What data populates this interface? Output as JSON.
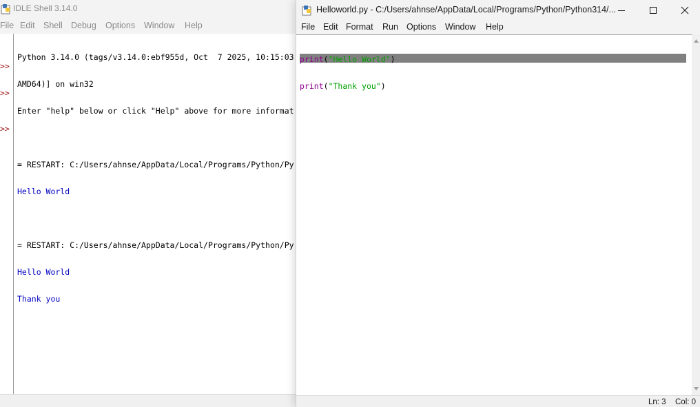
{
  "shell": {
    "title": "IDLE Shell 3.14.0",
    "menu": [
      "File",
      "Edit",
      "Shell",
      "Debug",
      "Options",
      "Window",
      "Help"
    ],
    "lines": [
      "Python 3.14.0 (tags/v3.14.0:ebf955d, Oct  7 2025, 10:15:03",
      "AMD64)] on win32",
      "Enter \"help\" below or click \"Help\" above for more informat",
      "",
      "= RESTART: C:/Users/ahnse/AppData/Local/Programs/Python/Py",
      "Hello World",
      "",
      "= RESTART: C:/Users/ahnse/AppData/Local/Programs/Python/Py",
      "Hello World",
      "Thank you"
    ],
    "prompt": ">>"
  },
  "editor": {
    "title": "Helloworld.py - C:/Users/ahnse/AppData/Local/Programs/Python/Python314/...",
    "menu": [
      "File",
      "Edit",
      "Format",
      "Run",
      "Options",
      "Window",
      "Help"
    ],
    "code": [
      {
        "func": "print",
        "open": "(",
        "str": "\"Hello World\"",
        "close": ")"
      },
      {
        "func": "print",
        "open": "(",
        "str": "\"Thank you\"",
        "close": ")"
      }
    ],
    "status": {
      "line": "Ln: 3",
      "col": "Col: 0"
    }
  },
  "icons": {
    "app": "python-idle-icon",
    "minimize": "minimize-icon",
    "maximize": "maximize-icon",
    "close": "close-icon",
    "scroll_up": "scroll-up-arrow-icon",
    "scroll_down": "scroll-down-arrow-icon"
  },
  "colors": {
    "shell_output": "#0000c0",
    "prompt": "#9b1010",
    "keyword_builtin": "#900090",
    "string": "#00a000",
    "current_line_highlight": "#808080"
  }
}
